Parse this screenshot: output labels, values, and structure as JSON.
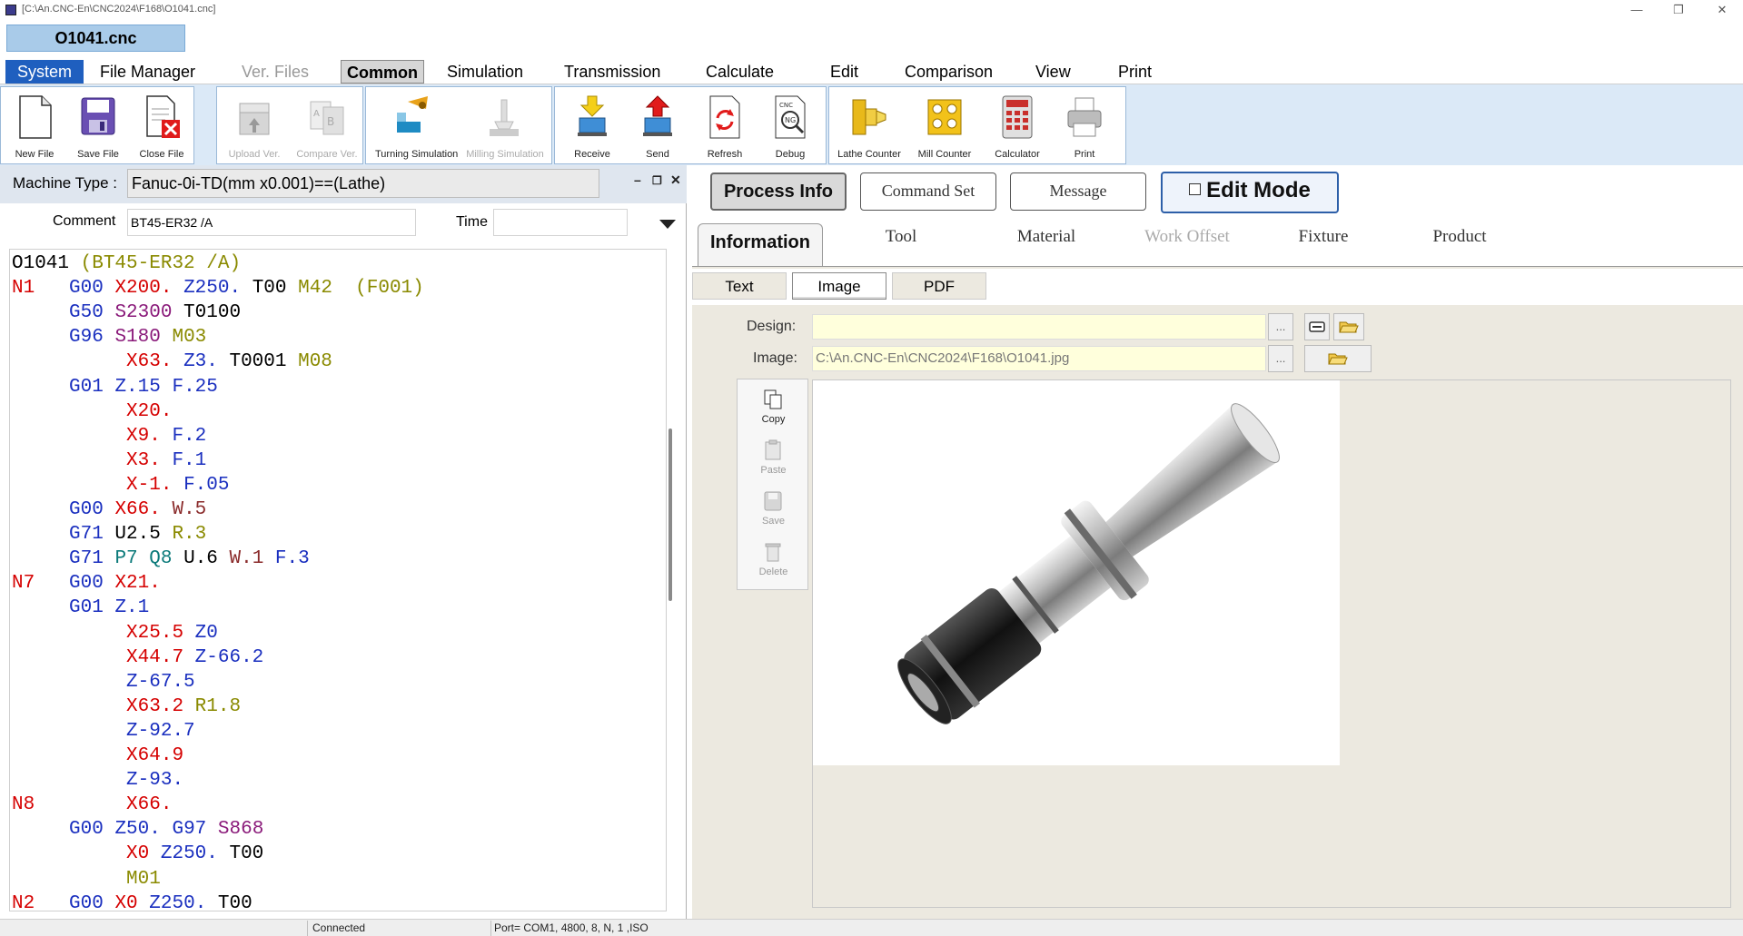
{
  "window": {
    "title": "[C:\\An.CNC-En\\CNC2024\\F168\\O1041.cnc]",
    "file_tab": "O1041.cnc"
  },
  "menu": [
    "System",
    "File Manager",
    "Ver. Files",
    "Common",
    "Simulation",
    "Transmission",
    "Calculate",
    "Edit",
    "Comparison",
    "View",
    "Print"
  ],
  "toolbar": {
    "new_file": "New File",
    "save_file": "Save File",
    "close_file": "Close File",
    "upload_ver": "Upload Ver.",
    "compare_ver": "Compare Ver.",
    "turning_sim": "Turning Simulation",
    "milling_sim": "Milling Simulation",
    "receive": "Receive",
    "send": "Send",
    "refresh": "Refresh",
    "debug": "Debug",
    "lathe_counter": "Lathe Counter",
    "mill_counter": "Mill Counter",
    "calculator": "Calculator",
    "print": "Print"
  },
  "left": {
    "machine_type_label": "Machine Type :",
    "machine_type_value": "Fanuc-0i-TD(mm x0.001)==(Lathe)",
    "comment_label": "Comment",
    "comment_value": "BT45-ER32 /A",
    "time_label": "Time",
    "time_value": ""
  },
  "code": [
    [
      [
        "O1041 ",
        "black"
      ],
      [
        "(BT45-ER32 /A)",
        "olive"
      ]
    ],
    [
      [
        "N1",
        "red"
      ],
      [
        "   ",
        "black"
      ],
      [
        "G00",
        "blue"
      ],
      [
        " ",
        "black"
      ],
      [
        "X200.",
        "red"
      ],
      [
        " ",
        "black"
      ],
      [
        "Z250.",
        "blue"
      ],
      [
        " T00 ",
        "black"
      ],
      [
        "M42",
        "olive"
      ],
      [
        "  ",
        "black"
      ],
      [
        "(F001)",
        "olive"
      ]
    ],
    [
      [
        "     ",
        "black"
      ],
      [
        "G50",
        "blue"
      ],
      [
        " ",
        "black"
      ],
      [
        "S2300",
        "purple"
      ],
      [
        " T0100",
        "black"
      ]
    ],
    [
      [
        "     ",
        "black"
      ],
      [
        "G96",
        "blue"
      ],
      [
        " ",
        "black"
      ],
      [
        "S180",
        "purple"
      ],
      [
        " ",
        "black"
      ],
      [
        "M03",
        "olive"
      ]
    ],
    [
      [
        "          ",
        "black"
      ],
      [
        "X63.",
        "red"
      ],
      [
        " ",
        "black"
      ],
      [
        "Z3.",
        "blue"
      ],
      [
        " T0001 ",
        "black"
      ],
      [
        "M08",
        "olive"
      ]
    ],
    [
      [
        "     ",
        "black"
      ],
      [
        "G01",
        "blue"
      ],
      [
        " ",
        "black"
      ],
      [
        "Z.15",
        "blue"
      ],
      [
        " ",
        "black"
      ],
      [
        "F.25",
        "blue"
      ]
    ],
    [
      [
        "          ",
        "black"
      ],
      [
        "X20.",
        "red"
      ]
    ],
    [
      [
        "          ",
        "black"
      ],
      [
        "X9.",
        "red"
      ],
      [
        " ",
        "black"
      ],
      [
        "F.2",
        "blue"
      ]
    ],
    [
      [
        "          ",
        "black"
      ],
      [
        "X3.",
        "red"
      ],
      [
        " ",
        "black"
      ],
      [
        "F.1",
        "blue"
      ]
    ],
    [
      [
        "          ",
        "black"
      ],
      [
        "X-1.",
        "red"
      ],
      [
        " ",
        "black"
      ],
      [
        "F.05",
        "blue"
      ]
    ],
    [
      [
        "     ",
        "black"
      ],
      [
        "G00",
        "blue"
      ],
      [
        " ",
        "black"
      ],
      [
        "X66.",
        "red"
      ],
      [
        " ",
        "black"
      ],
      [
        "W.5",
        "maroon"
      ]
    ],
    [
      [
        "     ",
        "black"
      ],
      [
        "G71",
        "blue"
      ],
      [
        " U2.5 ",
        "black"
      ],
      [
        "R.3",
        "olive"
      ]
    ],
    [
      [
        "     ",
        "black"
      ],
      [
        "G71",
        "blue"
      ],
      [
        " ",
        "black"
      ],
      [
        "P7",
        "teal"
      ],
      [
        " ",
        "black"
      ],
      [
        "Q8",
        "teal"
      ],
      [
        " U.6 ",
        "black"
      ],
      [
        "W.1",
        "maroon"
      ],
      [
        " ",
        "black"
      ],
      [
        "F.3",
        "blue"
      ]
    ],
    [
      [
        "N7",
        "red"
      ],
      [
        "   ",
        "black"
      ],
      [
        "G00",
        "blue"
      ],
      [
        " ",
        "black"
      ],
      [
        "X21.",
        "red"
      ]
    ],
    [
      [
        "     ",
        "black"
      ],
      [
        "G01",
        "blue"
      ],
      [
        " ",
        "black"
      ],
      [
        "Z.1",
        "blue"
      ]
    ],
    [
      [
        "          ",
        "black"
      ],
      [
        "X25.5",
        "red"
      ],
      [
        " ",
        "black"
      ],
      [
        "Z0",
        "blue"
      ]
    ],
    [
      [
        "          ",
        "black"
      ],
      [
        "X44.7",
        "red"
      ],
      [
        " ",
        "black"
      ],
      [
        "Z-66.2",
        "blue"
      ]
    ],
    [
      [
        "          ",
        "black"
      ],
      [
        "Z-67.5",
        "blue"
      ]
    ],
    [
      [
        "          ",
        "black"
      ],
      [
        "X63.2",
        "red"
      ],
      [
        " ",
        "black"
      ],
      [
        "R1.8",
        "olive"
      ]
    ],
    [
      [
        "          ",
        "black"
      ],
      [
        "Z-92.7",
        "blue"
      ]
    ],
    [
      [
        "          ",
        "black"
      ],
      [
        "X64.9",
        "red"
      ]
    ],
    [
      [
        "          ",
        "black"
      ],
      [
        "Z-93.",
        "blue"
      ]
    ],
    [
      [
        "N8",
        "red"
      ],
      [
        "        ",
        "black"
      ],
      [
        "X66.",
        "red"
      ]
    ],
    [
      [
        "     ",
        "black"
      ],
      [
        "G00",
        "blue"
      ],
      [
        " ",
        "black"
      ],
      [
        "Z50.",
        "blue"
      ],
      [
        " ",
        "black"
      ],
      [
        "G97",
        "blue"
      ],
      [
        " ",
        "black"
      ],
      [
        "S868",
        "purple"
      ]
    ],
    [
      [
        "          ",
        "black"
      ],
      [
        "X0",
        "red"
      ],
      [
        " ",
        "black"
      ],
      [
        "Z250.",
        "blue"
      ],
      [
        " T00",
        "black"
      ]
    ],
    [
      [
        "          ",
        "black"
      ],
      [
        "M01",
        "olive"
      ]
    ],
    [
      [
        "N2",
        "red"
      ],
      [
        "   ",
        "black"
      ],
      [
        "G00",
        "blue"
      ],
      [
        " ",
        "black"
      ],
      [
        "X0",
        "red"
      ],
      [
        " ",
        "black"
      ],
      [
        "Z250.",
        "blue"
      ],
      [
        " T00",
        "black"
      ]
    ]
  ],
  "right": {
    "buttons": {
      "process_info": "Process Info",
      "command_set": "Command Set",
      "message": "Message",
      "edit_mode": "Edit Mode"
    },
    "tabs": [
      "Information",
      "Tool",
      "Material",
      "Work Offset",
      "Fixture",
      "Product"
    ],
    "type_tabs": [
      "Text",
      "Image",
      "PDF"
    ],
    "design_label": "Design:",
    "design_value": "",
    "image_label": "Image:",
    "image_value": "C:\\An.CNC-En\\CNC2024\\F168\\O1041.jpg",
    "browse": "...",
    "side": {
      "copy": "Copy",
      "paste": "Paste",
      "save": "Save",
      "delete": "Delete"
    }
  },
  "status": {
    "connected": "Connected",
    "port": "Port= COM1, 4800, 8, N, 1 ,ISO"
  },
  "colors": {
    "black": "#000000",
    "red": "#d50000",
    "blue": "#1a2fbf",
    "olive": "#8a8a00",
    "maroon": "#8a2a2a",
    "teal": "#0b7a7a",
    "purple": "#8a1a7a"
  }
}
